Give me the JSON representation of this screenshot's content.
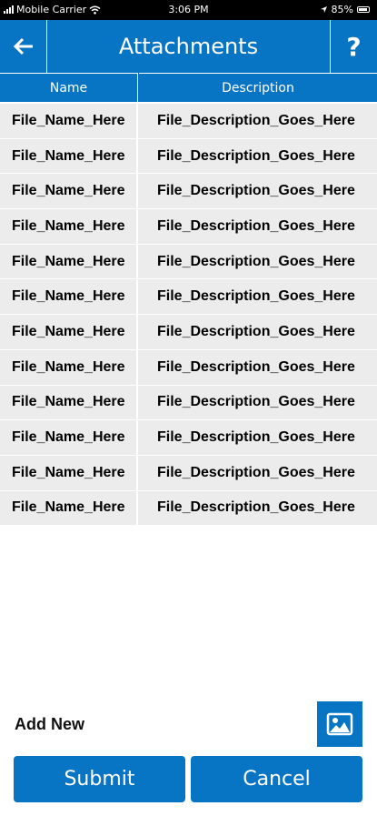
{
  "status_bar": {
    "carrier": "Mobile Carrier",
    "time": "3:06 PM",
    "battery": "85%"
  },
  "header": {
    "title": "Attachments",
    "back_icon": "arrow-left-icon",
    "help_label": "?"
  },
  "table": {
    "columns": [
      "Name",
      "Description"
    ],
    "rows": [
      {
        "name": "File_Name_Here",
        "description": "File_Description_Goes_Here"
      },
      {
        "name": "File_Name_Here",
        "description": "File_Description_Goes_Here"
      },
      {
        "name": "File_Name_Here",
        "description": "File_Description_Goes_Here"
      },
      {
        "name": "File_Name_Here",
        "description": "File_Description_Goes_Here"
      },
      {
        "name": "File_Name_Here",
        "description": "File_Description_Goes_Here"
      },
      {
        "name": "File_Name_Here",
        "description": "File_Description_Goes_Here"
      },
      {
        "name": "File_Name_Here",
        "description": "File_Description_Goes_Here"
      },
      {
        "name": "File_Name_Here",
        "description": "File_Description_Goes_Here"
      },
      {
        "name": "File_Name_Here",
        "description": "File_Description_Goes_Here"
      },
      {
        "name": "File_Name_Here",
        "description": "File_Description_Goes_Here"
      },
      {
        "name": "File_Name_Here",
        "description": "File_Description_Goes_Here"
      },
      {
        "name": "File_Name_Here",
        "description": "File_Description_Goes_Here"
      }
    ]
  },
  "add_new": {
    "label": "Add New",
    "icon": "image-icon"
  },
  "actions": {
    "submit_label": "Submit",
    "cancel_label": "Cancel"
  },
  "colors": {
    "accent": "#0874c4",
    "row_background": "#ececec"
  }
}
